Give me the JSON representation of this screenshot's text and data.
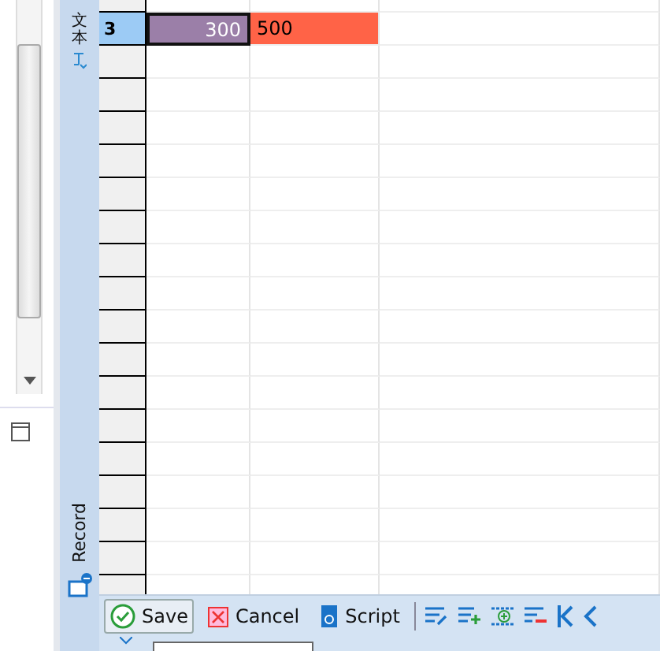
{
  "side_tabs": [
    {
      "label": "文本",
      "kind": "vertical-cjk"
    },
    {
      "label": "Record",
      "kind": "rotated"
    }
  ],
  "grid": {
    "rows": [
      {
        "header": "3",
        "selected": true,
        "cells": [
          {
            "text": "300",
            "color": "#9b7fa8"
          },
          {
            "text": "500",
            "color": "#ff6347"
          }
        ]
      }
    ]
  },
  "toolbar": {
    "buttons": [
      {
        "label": "Save",
        "kind": "save"
      },
      {
        "label": "Cancel",
        "kind": "cancel"
      },
      {
        "label": "Script",
        "kind": "script"
      }
    ],
    "icons": [
      {
        "kind": "edit-list"
      },
      {
        "kind": "add-row"
      },
      {
        "kind": "add-column"
      },
      {
        "kind": "remove-row"
      },
      {
        "kind": "first"
      },
      {
        "kind": "previous"
      }
    ]
  }
}
